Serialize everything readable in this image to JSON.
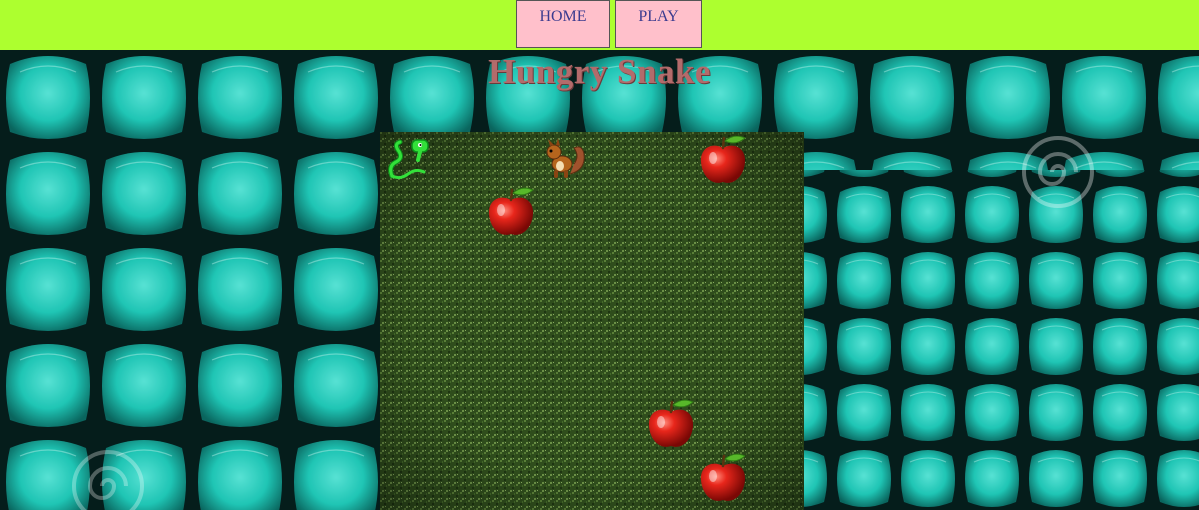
{
  "nav": {
    "home_label": "HOME",
    "play_label": "PLAY"
  },
  "title": "Hungry Snake",
  "game": {
    "board": "grass",
    "snake": "green-snake",
    "enemy": "squirrel",
    "food": "apple",
    "apple_count": 4
  },
  "colors": {
    "nav_bg": "#adff2f",
    "nav_button_bg": "#ffc0cb",
    "nav_text": "#3b3b8f",
    "title_text": "#b36b6b",
    "skin_cyan": "#2fe6d4"
  }
}
